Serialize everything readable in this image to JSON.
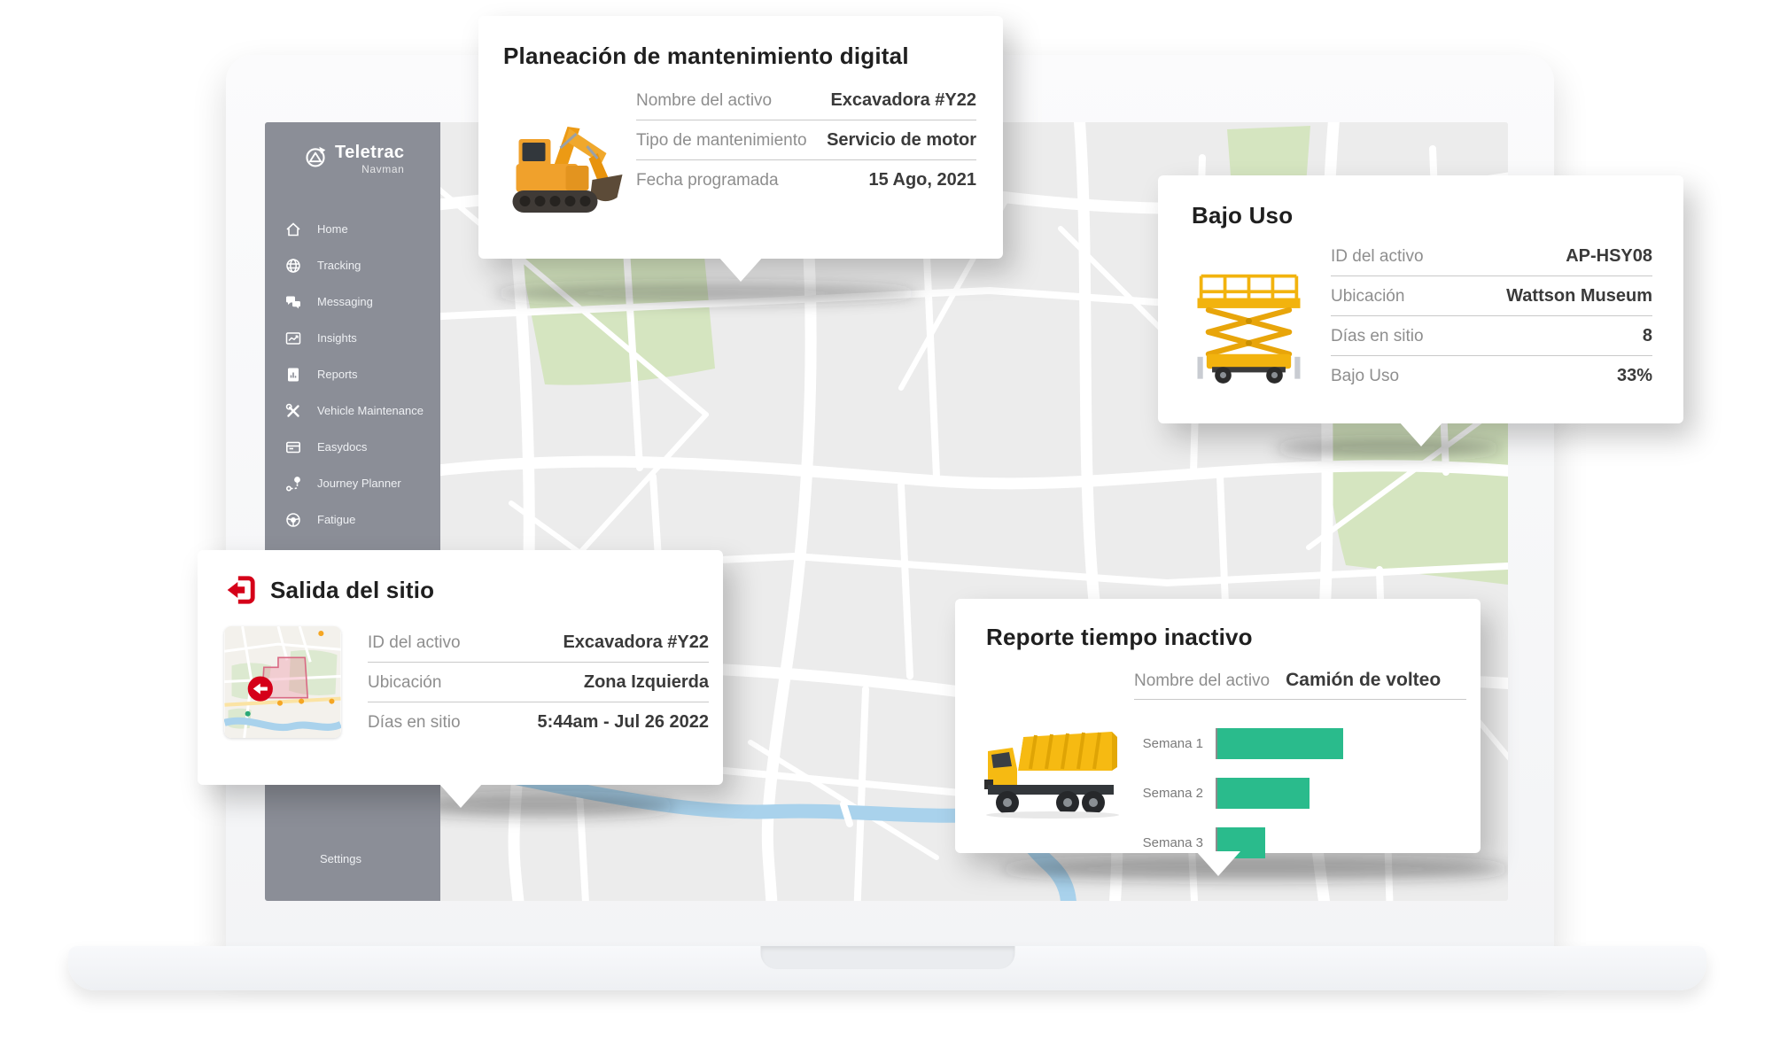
{
  "brand": {
    "name": "Teletrac",
    "sub": "Navman",
    "logo_icon": "teletrac-logo-icon"
  },
  "sidebar": {
    "items": [
      {
        "label": "Home",
        "icon": "home-icon"
      },
      {
        "label": "Tracking",
        "icon": "globe-icon"
      },
      {
        "label": "Messaging",
        "icon": "chat-bubbles-icon"
      },
      {
        "label": "Insights",
        "icon": "line-chart-icon"
      },
      {
        "label": "Reports",
        "icon": "report-doc-icon"
      },
      {
        "label": "Vehicle Maintenance",
        "icon": "crossed-tools-icon"
      },
      {
        "label": "Easydocs",
        "icon": "document-card-icon"
      },
      {
        "label": "Journey Planner",
        "icon": "route-pin-icon"
      },
      {
        "label": "Fatigue",
        "icon": "steering-wheel-icon"
      }
    ],
    "settings_label": "Settings"
  },
  "cards": {
    "maintenance": {
      "title": "Planeación de mantenimiento digital",
      "image": "excavator-illustration",
      "rows": [
        {
          "label": "Nombre del activo",
          "value": "Excavadora #Y22"
        },
        {
          "label": "Tipo de mantenimiento",
          "value": "Servicio de motor"
        },
        {
          "label": "Fecha programada",
          "value": "15 Ago, 2021"
        }
      ]
    },
    "low_use": {
      "title": "Bajo Uso",
      "image": "scissor-lift-illustration",
      "rows": [
        {
          "label": "ID del activo",
          "value": "AP-HSY08"
        },
        {
          "label": "Ubicación",
          "value": "Wattson Museum"
        },
        {
          "label": "Días en sitio",
          "value": "8"
        },
        {
          "label": "Bajo Uso",
          "value": "33%"
        }
      ]
    },
    "site_exit": {
      "title": "Salida del sitio",
      "icon": "exit-arrow-icon",
      "image": "geofence-minimap",
      "rows": [
        {
          "label": "ID del activo",
          "value": "Excavadora #Y22"
        },
        {
          "label": "Ubicación",
          "value": "Zona Izquierda"
        },
        {
          "label": "Días en sitio",
          "value": "5:44am - Jul 26 2022"
        }
      ]
    },
    "idle_report": {
      "title": "Reporte tiempo inactivo",
      "image": "dump-truck-illustration",
      "asset_label": "Nombre del activo",
      "asset_value": "Camión de volteo"
    }
  },
  "chart_data": {
    "type": "bar",
    "orientation": "horizontal",
    "title": "Reporte tiempo inactivo",
    "categories": [
      "Semana 1",
      "Semana 2",
      "Semana 3"
    ],
    "values": [
      100,
      73,
      38
    ],
    "value_unit": "percent of longest bar (no axis labels shown)",
    "xlim": [
      0,
      100
    ],
    "grid": false,
    "legend": false,
    "bar_color": "#2abb8c"
  },
  "colors": {
    "accent_red": "#d50019",
    "bar_green": "#2abb8c",
    "sidebar_gray": "#8b8e97",
    "map_background": "#ececec",
    "park_green": "#d5e5c0",
    "river_blue": "#a9d2ec",
    "geofence_pink": "#f0a3b5"
  }
}
